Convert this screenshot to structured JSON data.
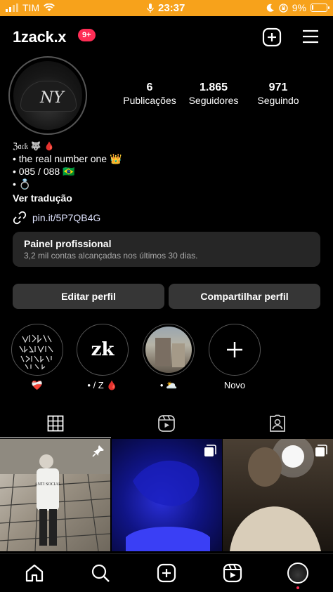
{
  "status_bar": {
    "carrier": "TIM",
    "time": "23:37",
    "battery": "9%",
    "battery_level": 0.09
  },
  "header": {
    "username": "1zack.x",
    "notifications_badge": "9+"
  },
  "stats": {
    "posts_count": "6",
    "posts_label": "Publicações",
    "followers_count": "1.865",
    "followers_label": "Seguidores",
    "following_count": "971",
    "following_label": "Seguindo"
  },
  "bio": {
    "name": "ℨ𝔞𝔠𝔨 🐺 🩸",
    "line1": "• the real number one 👑",
    "line2": "• 085 / 088 🇧🇷",
    "line3": "• 💍",
    "translate_label": "Ver tradução",
    "link": "pin.it/5P7QB4G"
  },
  "professional_panel": {
    "title": "Painel profissional",
    "subtitle": "3,2 mil contas alcançadas nos últimos 30 dias."
  },
  "buttons": {
    "edit_profile": "Editar perfil",
    "share_profile": "Compartilhar perfil"
  },
  "highlights": [
    {
      "label": "❤️‍🩹"
    },
    {
      "label": "• / Z 🩸",
      "cover_text": "zk"
    },
    {
      "label": "• 🌥️"
    },
    {
      "label": "Novo"
    }
  ],
  "colors": {
    "status_bar": "#f7a21b",
    "badge": "#ff2d55",
    "button_bg": "#363636",
    "panel_bg": "#262626"
  }
}
